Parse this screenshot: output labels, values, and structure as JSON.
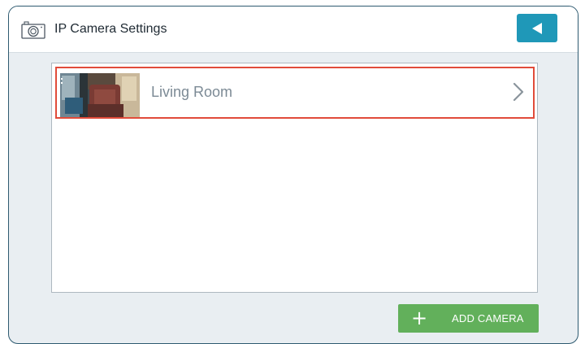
{
  "header": {
    "title": "IP Camera Settings",
    "icon": "camera-icon",
    "back_icon": "back-arrow-icon",
    "back_color": "#1f98b8"
  },
  "cameras": [
    {
      "label": "Living Room",
      "thumbnail": "living-room-camera-thumbnail",
      "selected": true,
      "highlight_color": "#e14b3a"
    }
  ],
  "footer": {
    "add_label": "ADD CAMERA",
    "add_icon": "plus-icon",
    "add_color": "#62b05b"
  }
}
